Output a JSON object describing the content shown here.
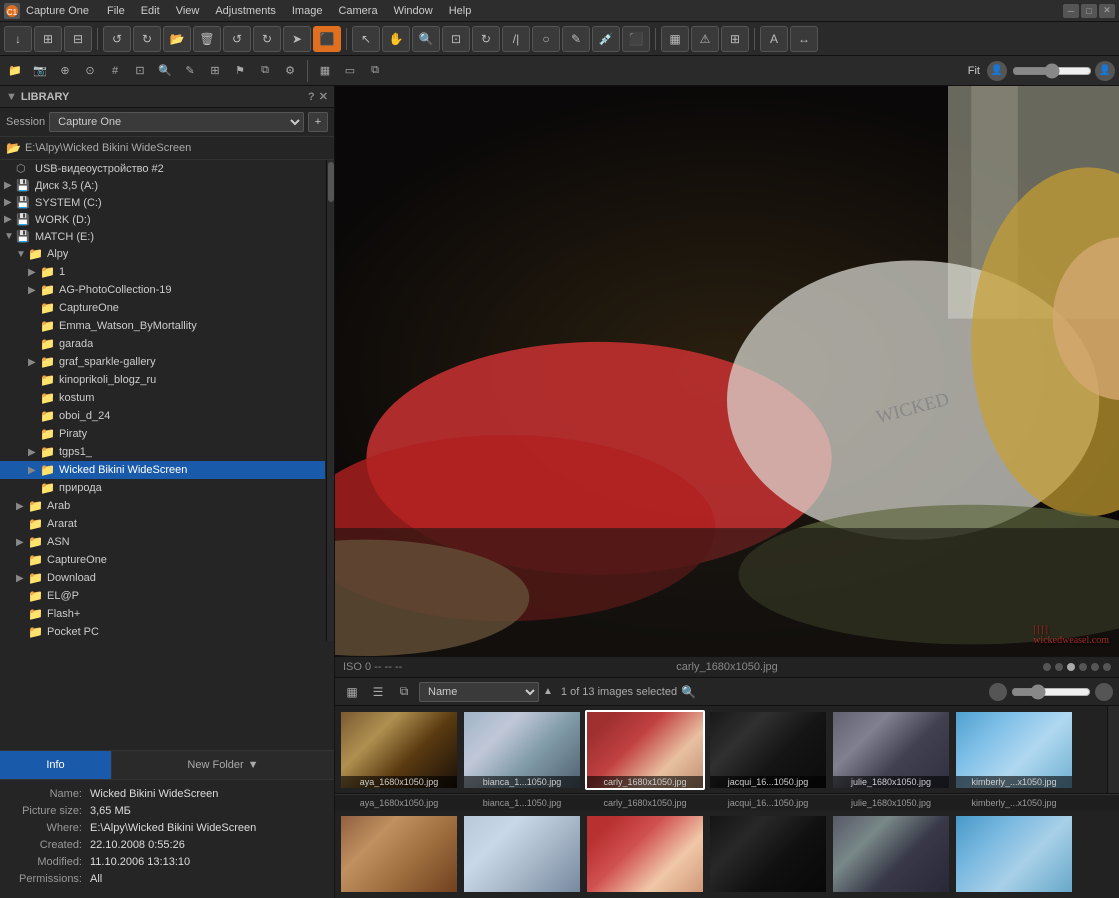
{
  "app": {
    "title": "Capture One",
    "icon": "C1"
  },
  "menubar": {
    "items": [
      "File",
      "Edit",
      "View",
      "Adjustments",
      "Image",
      "Camera",
      "Window",
      "Help"
    ]
  },
  "toolbar1": {
    "buttons": [
      {
        "name": "arrow-down",
        "icon": "↓"
      },
      {
        "name": "grid-view",
        "icon": "⊞"
      },
      {
        "name": "grid-view2",
        "icon": "⊟"
      },
      {
        "name": "undo",
        "icon": "↺"
      },
      {
        "name": "redo-alt",
        "icon": "↻"
      },
      {
        "name": "folder-open",
        "icon": "📂"
      },
      {
        "name": "delete",
        "icon": "🗑"
      },
      {
        "name": "rotate-left",
        "icon": "↰"
      },
      {
        "name": "rotate-right-2",
        "icon": "↱"
      },
      {
        "name": "rotate-right",
        "icon": "➤"
      },
      {
        "name": "export",
        "icon": "⬛"
      }
    ],
    "tools": [
      {
        "name": "cursor",
        "icon": "↖"
      },
      {
        "name": "pan",
        "icon": "✋"
      },
      {
        "name": "zoom-tool",
        "icon": "🔍"
      },
      {
        "name": "crop",
        "icon": "⊡"
      },
      {
        "name": "rotate-tool",
        "icon": "↻"
      },
      {
        "name": "lines",
        "icon": "≡"
      },
      {
        "name": "circle",
        "icon": "○"
      },
      {
        "name": "pen",
        "icon": "✎"
      },
      {
        "name": "eyedropper",
        "icon": "💉"
      },
      {
        "name": "brush",
        "icon": "⬛"
      }
    ],
    "view_btns": [
      {
        "name": "grid-lg",
        "icon": "▦"
      },
      {
        "name": "compare",
        "icon": "⧉"
      },
      {
        "name": "warning",
        "icon": "⚠"
      },
      {
        "name": "grid-sm",
        "icon": "⊞"
      }
    ],
    "text_btn": {
      "icon": "A"
    },
    "expand_btn": {
      "icon": "↔"
    }
  },
  "toolbar2": {
    "tools": [
      {
        "name": "folder-tool",
        "icon": "📁"
      },
      {
        "name": "camera-tool",
        "icon": "📷"
      },
      {
        "name": "adjust-tool",
        "icon": "⊕"
      },
      {
        "name": "circle-tool",
        "icon": "⊙"
      },
      {
        "name": "number-tool",
        "icon": "#"
      },
      {
        "name": "crop-tool",
        "icon": "⊡"
      },
      {
        "name": "search-tool",
        "icon": "🔍"
      },
      {
        "name": "pen-tool",
        "icon": "✎"
      },
      {
        "name": "grid-tool",
        "icon": "⊞"
      },
      {
        "name": "flag-tool",
        "icon": "⚑"
      },
      {
        "name": "compare-tool",
        "icon": "⧉"
      },
      {
        "name": "settings-tool",
        "icon": "⚙"
      }
    ],
    "view_btns": [
      {
        "name": "view-grid",
        "icon": "▦"
      },
      {
        "name": "view-single",
        "icon": "▭"
      },
      {
        "name": "view-compare",
        "icon": "⧉"
      }
    ],
    "fit_label": "Fit",
    "zoom_value": 50
  },
  "library": {
    "title": "LIBRARY",
    "session_label": "Session",
    "session_value": "Capture One",
    "current_path": "E:\\Alpy\\Wicked Bikini WideScreen",
    "tree": [
      {
        "level": 0,
        "icon": "usb",
        "label": "USB-видеоустройство #2",
        "expanded": false,
        "arrow": false
      },
      {
        "level": 0,
        "icon": "hdd",
        "label": "Диск 3,5 (A:)",
        "expanded": false,
        "arrow": true
      },
      {
        "level": 0,
        "icon": "hdd",
        "label": "SYSTEM (C:)",
        "expanded": false,
        "arrow": true
      },
      {
        "level": 0,
        "icon": "hdd",
        "label": "WORK (D:)",
        "expanded": false,
        "arrow": true
      },
      {
        "level": 0,
        "icon": "hdd",
        "label": "MATCH (E:)",
        "expanded": true,
        "arrow": true
      },
      {
        "level": 1,
        "icon": "folder",
        "label": "Alpy",
        "expanded": true,
        "arrow": true
      },
      {
        "level": 2,
        "icon": "folder",
        "label": "1",
        "expanded": false,
        "arrow": true
      },
      {
        "level": 2,
        "icon": "folder",
        "label": "AG-PhotoCollection-19",
        "expanded": false,
        "arrow": true
      },
      {
        "level": 2,
        "icon": "folder",
        "label": "CaptureOne",
        "expanded": false,
        "arrow": false
      },
      {
        "level": 2,
        "icon": "folder",
        "label": "Emma_Watson_ByMortallity",
        "expanded": false,
        "arrow": false
      },
      {
        "level": 2,
        "icon": "folder",
        "label": "garada",
        "expanded": false,
        "arrow": false
      },
      {
        "level": 2,
        "icon": "folder",
        "label": "graf_sparkle-gallery",
        "expanded": false,
        "arrow": true
      },
      {
        "level": 2,
        "icon": "folder",
        "label": "kinoprikoli_blogz_ru",
        "expanded": false,
        "arrow": false
      },
      {
        "level": 2,
        "icon": "folder",
        "label": "kostum",
        "expanded": false,
        "arrow": false
      },
      {
        "level": 2,
        "icon": "folder",
        "label": "oboi_d_24",
        "expanded": false,
        "arrow": false
      },
      {
        "level": 2,
        "icon": "folder",
        "label": "Piraty",
        "expanded": false,
        "arrow": false
      },
      {
        "level": 2,
        "icon": "folder",
        "label": "tgps1_",
        "expanded": false,
        "arrow": true
      },
      {
        "level": 2,
        "icon": "folder",
        "label": "Wicked Bikini WideScreen",
        "expanded": false,
        "arrow": true,
        "selected": true
      },
      {
        "level": 2,
        "icon": "folder",
        "label": "природа",
        "expanded": false,
        "arrow": false
      },
      {
        "level": 1,
        "icon": "folder",
        "label": "Arab",
        "expanded": false,
        "arrow": true
      },
      {
        "level": 1,
        "icon": "folder",
        "label": "Ararat",
        "expanded": false,
        "arrow": false
      },
      {
        "level": 1,
        "icon": "folder",
        "label": "ASN",
        "expanded": false,
        "arrow": true
      },
      {
        "level": 1,
        "icon": "folder",
        "label": "CaptureOne",
        "expanded": false,
        "arrow": false
      },
      {
        "level": 1,
        "icon": "folder",
        "label": "Download",
        "expanded": false,
        "arrow": true
      },
      {
        "level": 1,
        "icon": "folder",
        "label": "EL@P",
        "expanded": false,
        "arrow": false
      },
      {
        "level": 1,
        "icon": "folder",
        "label": "Flash+",
        "expanded": false,
        "arrow": false
      },
      {
        "level": 1,
        "icon": "folder",
        "label": "Pocket PC",
        "expanded": false,
        "arrow": false
      }
    ]
  },
  "bottom_tabs": {
    "info_label": "Info",
    "new_folder_label": "New Folder"
  },
  "info": {
    "name_label": "Name:",
    "name_value": "Wicked Bikini WideScreen",
    "picture_size_label": "Picture size:",
    "picture_size_value": "3,65 МБ",
    "where_label": "Where:",
    "where_value": "E:\\Alpy\\Wicked Bikini WideScreen",
    "created_label": "Created:",
    "created_value": "22.10.2008 0:55:26",
    "modified_label": "Modified:",
    "modified_value": "11.10.2006 13:13:10",
    "permissions_label": "Permissions:",
    "permissions_value": "All"
  },
  "status_bar": {
    "left": "ISO 0  --  -- --",
    "center": "carly_1680x1050.jpg",
    "dots": [
      false,
      false,
      true,
      false,
      false,
      false
    ]
  },
  "filmstrip_toolbar": {
    "sort_label": "Name",
    "image_count": "1 of 13 images selected",
    "search_placeholder": "Search"
  },
  "filmstrip_row1": [
    {
      "label": "aya_1680x1050.jpg",
      "class": "thumb-1",
      "selected": false
    },
    {
      "label": "bianca_1...1050.jpg",
      "class": "thumb-2",
      "selected": false
    },
    {
      "label": "carly_1680x1050.jpg",
      "class": "thumb-3",
      "selected": true
    },
    {
      "label": "jacqui_16...1050.jpg",
      "class": "thumb-4",
      "selected": false
    },
    {
      "label": "julie_1680x1050.jpg",
      "class": "thumb-5",
      "selected": false
    },
    {
      "label": "kimberly_...x1050.jpg",
      "class": "thumb-6",
      "selected": false
    }
  ],
  "filmstrip_row2": [
    {
      "label": "aya_1680x1050.jpg",
      "class": "thumb-r1"
    },
    {
      "label": "bianca_1...1050.jpg",
      "class": "thumb-r2"
    },
    {
      "label": "carly_1680x1050.jpg",
      "class": "thumb-r3"
    },
    {
      "label": "jacqui_16...1050.jpg",
      "class": "thumb-r4"
    },
    {
      "label": "julie_1680x1050.jpg",
      "class": "thumb-r5"
    },
    {
      "label": "kimberly_...x1050.jpg",
      "class": "thumb-r6"
    }
  ],
  "watermark": "wickedweasel.com"
}
